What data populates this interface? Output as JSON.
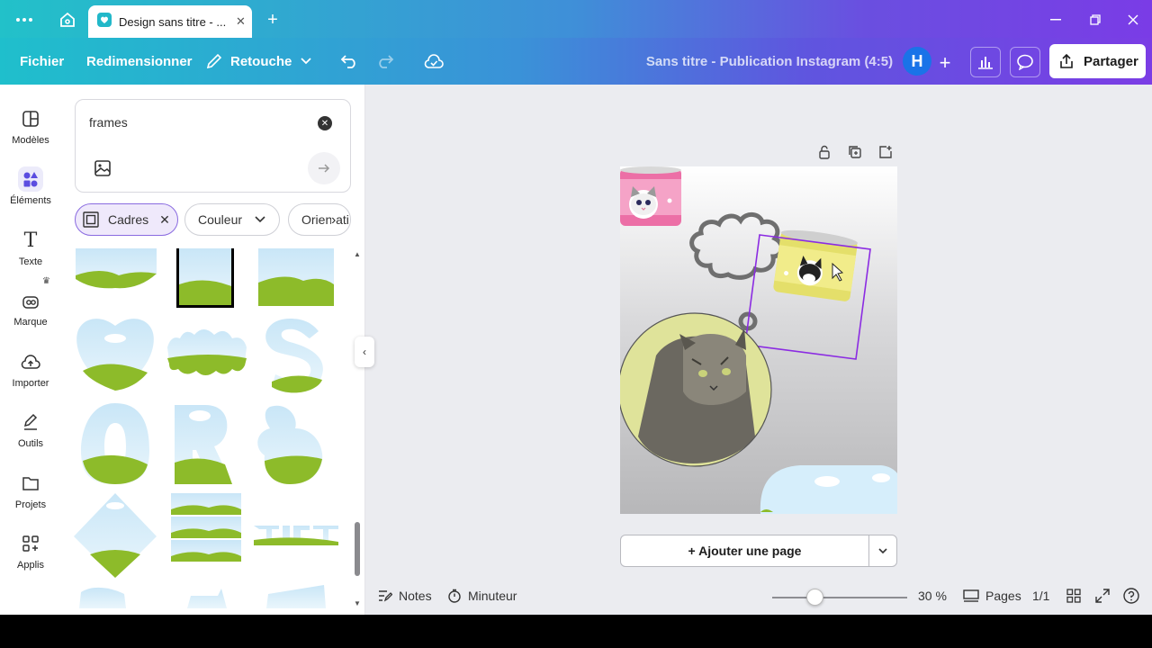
{
  "titlebar": {
    "tab_title": "Design sans titre - ...",
    "icons": [
      "more-icon",
      "home-icon",
      "canva-icon",
      "close-icon",
      "plus-icon",
      "minimize-icon",
      "restore-icon",
      "window-close-icon"
    ]
  },
  "toolbar": {
    "fichier": "Fichier",
    "redimensionner": "Redimensionner",
    "retouche": "Retouche",
    "doc_title": "Sans titre - Publication Instagram (4:5)",
    "avatar_letter": "H",
    "share_label": "Partager"
  },
  "rail": {
    "items": [
      {
        "label": "Modèles",
        "icon": "templates-icon"
      },
      {
        "label": "Éléments",
        "icon": "elements-icon"
      },
      {
        "label": "Texte",
        "icon": "text-icon"
      },
      {
        "label": "Marque",
        "icon": "brand-icon"
      },
      {
        "label": "Importer",
        "icon": "upload-icon"
      },
      {
        "label": "Outils",
        "icon": "tools-icon"
      },
      {
        "label": "Projets",
        "icon": "projects-icon"
      },
      {
        "label": "Applis",
        "icon": "apps-icon"
      }
    ]
  },
  "panel": {
    "search_value": "frames",
    "chips": {
      "cadres": "Cadres",
      "couleur": "Couleur",
      "orientation": "Orientati"
    }
  },
  "canvas": {
    "add_page": "+ Ajouter une page"
  },
  "footer": {
    "notes": "Notes",
    "minuteur": "Minuteur",
    "zoom": "30 %",
    "zoom_fraction": 0.3,
    "pages": "Pages",
    "page_count": "1/1"
  },
  "colors": {
    "accent_purple": "#7a3ce6",
    "accent_teal": "#22c1c9",
    "selection": "#8b2be2",
    "sky": "#d6eefb",
    "grass": "#8dbb2a"
  }
}
